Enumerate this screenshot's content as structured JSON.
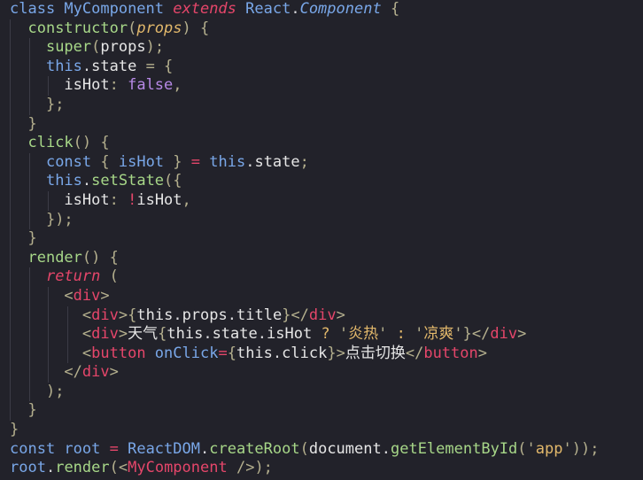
{
  "theme": {
    "background": "#22222a",
    "default": "#d9d9dc",
    "keyword": "#79a7e8",
    "type": "#79a7e8",
    "function": "#a7d788",
    "variable": "#79a7e8",
    "italic_kw": "#e5466a",
    "param": "#e2b86b",
    "string": "#e2b86b",
    "property": "#79a7e8",
    "punct": "#b5b08e",
    "tag": "#e5466a",
    "boolean": "#b789e6",
    "operator": "#e5466a",
    "white": "#e6e6e6",
    "guide": "#3b3b46"
  },
  "code_lines": [
    [
      [
        "class ",
        "keyword"
      ],
      [
        "MyComponent ",
        "type"
      ],
      [
        "extends ",
        "italic_kw"
      ],
      [
        "React",
        "type"
      ],
      [
        ".",
        "default"
      ],
      [
        "Component",
        "type"
      ],
      [
        " {",
        "punct"
      ]
    ],
    [
      [
        "  ",
        "default"
      ],
      [
        "constructor",
        "function"
      ],
      [
        "(",
        "punct"
      ],
      [
        "props",
        "param"
      ],
      [
        ") {",
        "punct"
      ]
    ],
    [
      [
        "    ",
        "default"
      ],
      [
        "super",
        "function"
      ],
      [
        "(",
        "punct"
      ],
      [
        "props",
        "white"
      ],
      [
        ");",
        "punct"
      ]
    ],
    [
      [
        "    ",
        "default"
      ],
      [
        "this",
        "keyword"
      ],
      [
        ".",
        "default"
      ],
      [
        "state",
        "white"
      ],
      [
        " = {",
        "punct"
      ]
    ],
    [
      [
        "      ",
        "default"
      ],
      [
        "isHot",
        "white"
      ],
      [
        ": ",
        "punct"
      ],
      [
        "false",
        "boolean"
      ],
      [
        ",",
        "punct"
      ]
    ],
    [
      [
        "    ",
        "default"
      ],
      [
        "};",
        "punct"
      ]
    ],
    [
      [
        "  ",
        "default"
      ],
      [
        "}",
        "punct"
      ]
    ],
    [
      [
        "  ",
        "default"
      ],
      [
        "click",
        "function"
      ],
      [
        "() {",
        "punct"
      ]
    ],
    [
      [
        "    ",
        "default"
      ],
      [
        "const ",
        "keyword"
      ],
      [
        "{ ",
        "punct"
      ],
      [
        "isHot",
        "variable"
      ],
      [
        " } ",
        "punct"
      ],
      [
        "= ",
        "operator"
      ],
      [
        "this",
        "keyword"
      ],
      [
        ".",
        "default"
      ],
      [
        "state",
        "white"
      ],
      [
        ";",
        "punct"
      ]
    ],
    [
      [
        "    ",
        "default"
      ],
      [
        "this",
        "keyword"
      ],
      [
        ".",
        "default"
      ],
      [
        "setState",
        "function"
      ],
      [
        "({",
        "punct"
      ]
    ],
    [
      [
        "      ",
        "default"
      ],
      [
        "isHot",
        "white"
      ],
      [
        ": ",
        "punct"
      ],
      [
        "!",
        "operator"
      ],
      [
        "isHot",
        "white"
      ],
      [
        ",",
        "punct"
      ]
    ],
    [
      [
        "    ",
        "default"
      ],
      [
        "});",
        "punct"
      ]
    ],
    [
      [
        "  ",
        "default"
      ],
      [
        "}",
        "punct"
      ]
    ],
    [
      [
        "  ",
        "default"
      ],
      [
        "render",
        "function"
      ],
      [
        "() {",
        "punct"
      ]
    ],
    [
      [
        "    ",
        "default"
      ],
      [
        "return ",
        "italic_kw"
      ],
      [
        "(",
        "punct"
      ]
    ],
    [
      [
        "      ",
        "default"
      ],
      [
        "<",
        "punct"
      ],
      [
        "div",
        "tag"
      ],
      [
        ">",
        "punct"
      ]
    ],
    [
      [
        "        ",
        "default"
      ],
      [
        "<",
        "punct"
      ],
      [
        "div",
        "tag"
      ],
      [
        ">",
        "punct"
      ],
      [
        "{",
        "punct"
      ],
      [
        "this",
        "white"
      ],
      [
        ".",
        "default"
      ],
      [
        "props",
        "white"
      ],
      [
        ".",
        "default"
      ],
      [
        "title",
        "white"
      ],
      [
        "}",
        "punct"
      ],
      [
        "</",
        "punct"
      ],
      [
        "div",
        "tag"
      ],
      [
        ">",
        "punct"
      ]
    ],
    [
      [
        "        ",
        "default"
      ],
      [
        "<",
        "punct"
      ],
      [
        "div",
        "tag"
      ],
      [
        ">",
        "punct"
      ],
      [
        "天气",
        "white"
      ],
      [
        "{",
        "punct"
      ],
      [
        "this",
        "white"
      ],
      [
        ".",
        "default"
      ],
      [
        "state",
        "white"
      ],
      [
        ".",
        "default"
      ],
      [
        "isHot",
        "white"
      ],
      [
        " ? ",
        "param"
      ],
      [
        "'",
        "punct"
      ],
      [
        "炎热",
        "string"
      ],
      [
        "'",
        "punct"
      ],
      [
        " : ",
        "param"
      ],
      [
        "'",
        "punct"
      ],
      [
        "凉爽",
        "string"
      ],
      [
        "'",
        "punct"
      ],
      [
        "}",
        "punct"
      ],
      [
        "</",
        "punct"
      ],
      [
        "div",
        "tag"
      ],
      [
        ">",
        "punct"
      ]
    ],
    [
      [
        "        ",
        "default"
      ],
      [
        "<",
        "punct"
      ],
      [
        "button ",
        "tag"
      ],
      [
        "onClick",
        "variable"
      ],
      [
        "=",
        "operator"
      ],
      [
        "{",
        "punct"
      ],
      [
        "this",
        "white"
      ],
      [
        ".",
        "default"
      ],
      [
        "click",
        "white"
      ],
      [
        "}",
        "punct"
      ],
      [
        ">",
        "punct"
      ],
      [
        "点击切换",
        "white"
      ],
      [
        "</",
        "punct"
      ],
      [
        "button",
        "tag"
      ],
      [
        ">",
        "punct"
      ]
    ],
    [
      [
        "      ",
        "default"
      ],
      [
        "</",
        "punct"
      ],
      [
        "div",
        "tag"
      ],
      [
        ">",
        "punct"
      ]
    ],
    [
      [
        "    ",
        "default"
      ],
      [
        ");",
        "punct"
      ]
    ],
    [
      [
        "  ",
        "default"
      ],
      [
        "}",
        "punct"
      ]
    ],
    [
      [
        "}",
        "punct"
      ]
    ],
    [
      [
        "const ",
        "keyword"
      ],
      [
        "root ",
        "variable"
      ],
      [
        "= ",
        "operator"
      ],
      [
        "ReactDOM",
        "type"
      ],
      [
        ".",
        "default"
      ],
      [
        "createRoot",
        "function"
      ],
      [
        "(",
        "punct"
      ],
      [
        "document",
        "white"
      ],
      [
        ".",
        "default"
      ],
      [
        "getElementById",
        "function"
      ],
      [
        "(",
        "punct"
      ],
      [
        "'",
        "punct"
      ],
      [
        "app",
        "string"
      ],
      [
        "'",
        "punct"
      ],
      [
        ")",
        "punct"
      ],
      [
        ");",
        "punct"
      ]
    ],
    [
      [
        "root",
        "variable"
      ],
      [
        ".",
        "default"
      ],
      [
        "render",
        "function"
      ],
      [
        "(",
        "punct"
      ],
      [
        "<",
        "punct"
      ],
      [
        "MyComponent ",
        "tag"
      ],
      [
        "/>",
        "punct"
      ],
      [
        ");",
        "punct"
      ]
    ]
  ]
}
